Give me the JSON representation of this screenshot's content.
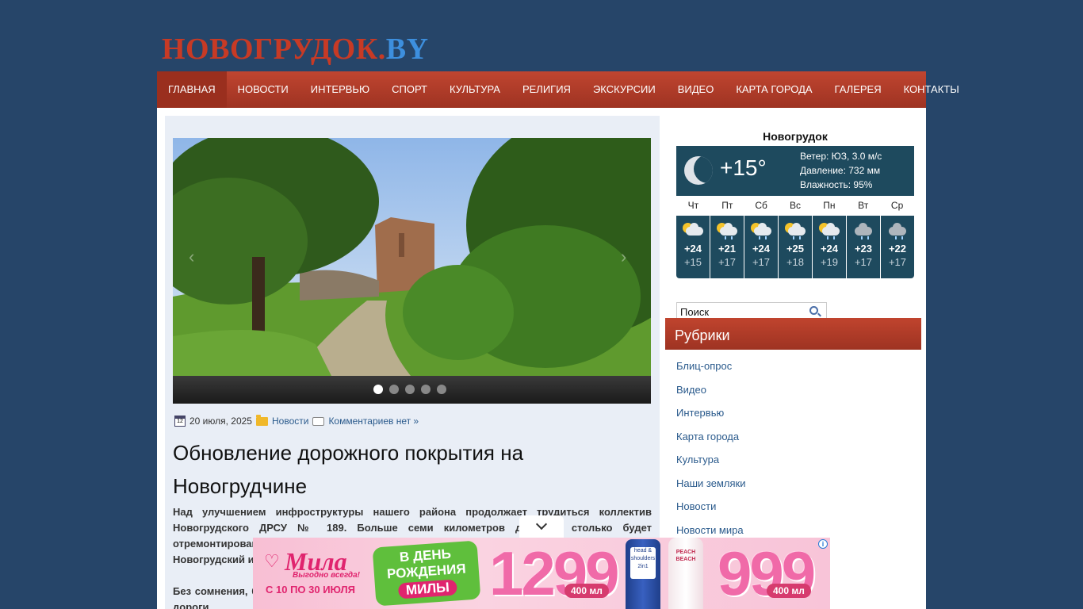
{
  "site": {
    "logo_part1": "НОВОГРУДОК.",
    "logo_part2": "BY"
  },
  "nav": {
    "items": [
      {
        "label": "ГЛАВНАЯ",
        "active": true
      },
      {
        "label": "НОВОСТИ"
      },
      {
        "label": "ИНТЕРВЬЮ"
      },
      {
        "label": "СПОРТ"
      },
      {
        "label": "КУЛЬТУРА"
      },
      {
        "label": "РЕЛИГИЯ"
      },
      {
        "label": "ЭКСКУРСИИ"
      },
      {
        "label": "ВИДЕО"
      },
      {
        "label": "КАРТА ГОРОДА"
      },
      {
        "label": "ГАЛЕРЕЯ"
      },
      {
        "label": "КОНТАКТЫ"
      }
    ]
  },
  "slider": {
    "dot_count": 5,
    "active_dot": 1
  },
  "article": {
    "cal_day": "12",
    "date": "20 июля, 2025",
    "category": "Новости",
    "comments": "Комментариев нет »",
    "title": "Обновление дорожного покрытия на Новогрудчине",
    "para1": "Над улучшением инфроструктуры нашего района продолжает трудиться коллектив Новогрудского ДРСУ № 189. Больше семи километров дорог – столько будет отремонтировано в текущем году. Об этом рассказал главный инженер предприятия. Новогрудский и Кореличский районы находятся в зоне обслуживания коллектива.",
    "para2": "Без сомнения, большой объём работ запланирован на эту неделю. Ремонтируется участок дороги"
  },
  "weather": {
    "city": "Новогрудок",
    "temp": "+15°",
    "wind": "Ветер: ЮЗ, 3.0 м/с",
    "pressure": "Давление: 732 мм",
    "humidity": "Влажность: 95%",
    "forecast": [
      {
        "day": "Чт",
        "hi": "+24",
        "lo": "+15",
        "icon": "sun-cloud-icon"
      },
      {
        "day": "Пт",
        "hi": "+21",
        "lo": "+17",
        "icon": "sun-cloud-rain-icon"
      },
      {
        "day": "Сб",
        "hi": "+24",
        "lo": "+17",
        "icon": "sun-cloud-rain-icon"
      },
      {
        "day": "Вс",
        "hi": "+25",
        "lo": "+18",
        "icon": "sun-cloud-rain-icon"
      },
      {
        "day": "Пн",
        "hi": "+24",
        "lo": "+19",
        "icon": "sun-cloud-rain-icon"
      },
      {
        "day": "Вт",
        "hi": "+23",
        "lo": "+17",
        "icon": "cloud-rain-icon"
      },
      {
        "day": "Ср",
        "hi": "+22",
        "lo": "+17",
        "icon": "cloud-rain-icon"
      }
    ]
  },
  "search": {
    "placeholder": "Поиск"
  },
  "rubrics": {
    "title": "Рубрики",
    "items": [
      "Блиц-опрос",
      "Видео",
      "Интервью",
      "Карта города",
      "Культура",
      "Наши земляки",
      "Новости",
      "Новости мира"
    ]
  },
  "ad": {
    "brand": "Мила",
    "slogan": "Выгодно всегда!",
    "dates": "С 10 ПО 30 ИЮЛЯ",
    "badge_line1": "В ДЕНЬ",
    "badge_line2": "РОЖДЕНИЯ",
    "badge_line3": "МИЛЫ",
    "price1": "1299",
    "volume1": "400 мл",
    "price2": "999",
    "volume2": "400 мл",
    "bottle1_label": "head & shoulders 2in1",
    "bottle2_label": "PEACH BEACH"
  },
  "colors": {
    "background": "#264569",
    "nav": "#b03d29",
    "logo_red": "#c73a25",
    "logo_blue": "#3d8fde",
    "weather_panel": "#1e4a5e",
    "link": "#2a5a8c"
  }
}
